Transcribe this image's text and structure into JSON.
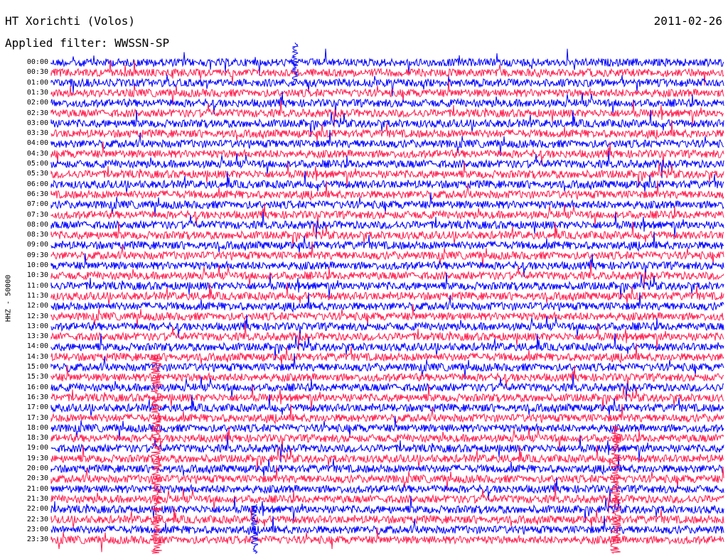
{
  "station_title": "HT Xorichti (Volos)",
  "date": "2011-02-26",
  "filter_label": "Applied filter: WWSSN-SP",
  "channel_label": "HHZ - 50000",
  "colors": {
    "line_even": "#0000ff",
    "line_odd": "#ff1f4f",
    "background": "#ffffff"
  },
  "time_labels": [
    "00:00",
    "00:30",
    "01:00",
    "01:30",
    "02:00",
    "02:30",
    "03:00",
    "03:30",
    "04:00",
    "04:30",
    "05:00",
    "05:30",
    "06:00",
    "06:30",
    "07:00",
    "07:30",
    "08:00",
    "08:30",
    "09:00",
    "09:30",
    "10:00",
    "10:30",
    "11:00",
    "11:30",
    "12:00",
    "12:30",
    "13:00",
    "13:30",
    "14:00",
    "14:30",
    "15:00",
    "15:30",
    "16:00",
    "16:30",
    "17:00",
    "17:30",
    "18:00",
    "18:30",
    "19:00",
    "19:30",
    "20:00",
    "20:30",
    "21:00",
    "21:30",
    "22:00",
    "22:30",
    "23:00",
    "23:30"
  ]
}
